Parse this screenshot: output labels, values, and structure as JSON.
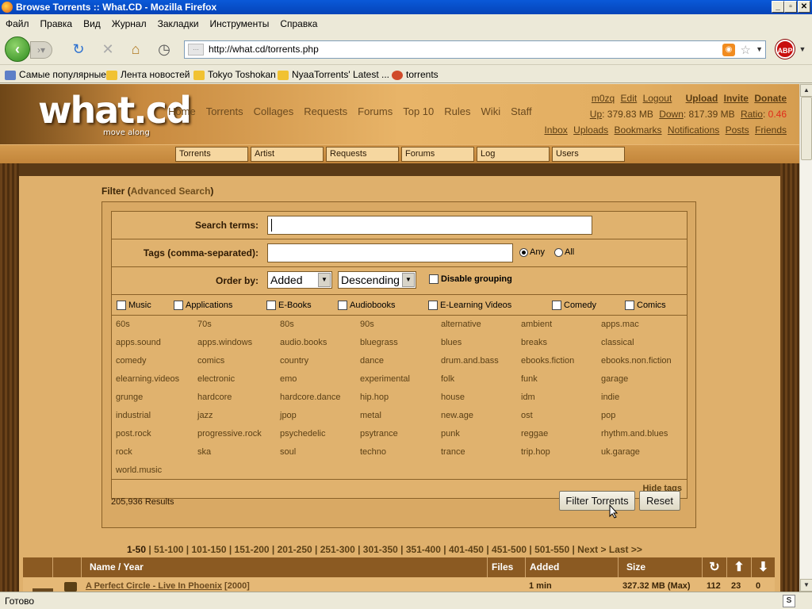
{
  "window": {
    "title": "Browse Torrents :: What.CD - Mozilla Firefox"
  },
  "menu": [
    "Файл",
    "Правка",
    "Вид",
    "Журнал",
    "Закладки",
    "Инструменты",
    "Справка"
  ],
  "url": "http://what.cd/torrents.php",
  "bookmarks": [
    "Самые популярные",
    "Лента новостей",
    "Tokyo Toshokan",
    "NyaaTorrents' Latest ...",
    "torrents"
  ],
  "site": {
    "logo": "what.cd",
    "logo_sub": "move along",
    "nav": [
      "Home",
      "Torrents",
      "Collages",
      "Requests",
      "Forums",
      "Top 10",
      "Rules",
      "Wiki",
      "Staff"
    ],
    "user": {
      "name": "m0zq",
      "edit": "Edit",
      "logout": "Logout",
      "upload": "Upload",
      "invite": "Invite",
      "donate": "Donate",
      "up_label": "Up",
      "up_value": ": 379.83 MB",
      "down_label": "Down",
      "down_value": ": 817.39 MB",
      "ratio_label": "Ratio",
      "ratio_sep": ":",
      "ratio_value": "0.46",
      "links": [
        "Inbox",
        "Uploads",
        "Bookmarks",
        "Notifications",
        "Posts",
        "Friends"
      ]
    },
    "search_boxes": [
      "Torrents",
      "Artist",
      "Requests",
      "Forums",
      "Log",
      "Users"
    ]
  },
  "filter": {
    "title": "Filter",
    "adv_open": "(",
    "advanced": "Advanced Search",
    "adv_close": ")",
    "search_label": "Search terms:",
    "tags_label": "Tags (comma-separated):",
    "any": "Any",
    "all": "All",
    "order_label": "Order by:",
    "order_value": "Added",
    "direction_value": "Descending",
    "disable_grouping": "Disable grouping",
    "categories": [
      "Music",
      "Applications",
      "E-Books",
      "Audiobooks",
      "E-Learning Videos",
      "Comedy",
      "Comics"
    ],
    "tags": [
      [
        "60s",
        "70s",
        "80s",
        "90s",
        "alternative",
        "ambient",
        "apps.mac"
      ],
      [
        "apps.sound",
        "apps.windows",
        "audio.books",
        "bluegrass",
        "blues",
        "breaks",
        "classical"
      ],
      [
        "comedy",
        "comics",
        "country",
        "dance",
        "drum.and.bass",
        "ebooks.fiction",
        "ebooks.non.fiction"
      ],
      [
        "elearning.videos",
        "electronic",
        "emo",
        "experimental",
        "folk",
        "funk",
        "garage"
      ],
      [
        "grunge",
        "hardcore",
        "hardcore.dance",
        "hip.hop",
        "house",
        "idm",
        "indie"
      ],
      [
        "industrial",
        "jazz",
        "jpop",
        "metal",
        "new.age",
        "ost",
        "pop"
      ],
      [
        "post.rock",
        "progressive.rock",
        "psychedelic",
        "psytrance",
        "punk",
        "reggae",
        "rhythm.and.blues"
      ],
      [
        "rock",
        "ska",
        "soul",
        "techno",
        "trance",
        "trip.hop",
        "uk.garage"
      ],
      [
        "world.music"
      ]
    ],
    "hide_tags": "Hide tags",
    "results": "205,936 Results",
    "filter_button": "Filter Torrents",
    "reset_button": "Reset"
  },
  "pager": {
    "current": "1-50",
    "pages": [
      "51-100",
      "101-150",
      "151-200",
      "201-250",
      "251-300",
      "301-350",
      "351-400",
      "401-450",
      "451-500",
      "501-550"
    ],
    "next": "Next >",
    "last": "Last >>"
  },
  "table": {
    "headers": {
      "name": "Name / Year",
      "files": "Files",
      "added": "Added",
      "size": "Size"
    },
    "rows": [
      {
        "name": "A Perfect Circle - Live In Phoenix",
        "year": "[2000]",
        "added": "1 min",
        "size": "327.32 MB (Max)",
        "snatches": "112",
        "seeders": "23",
        "leechers": "0"
      }
    ]
  },
  "status": "Готово"
}
